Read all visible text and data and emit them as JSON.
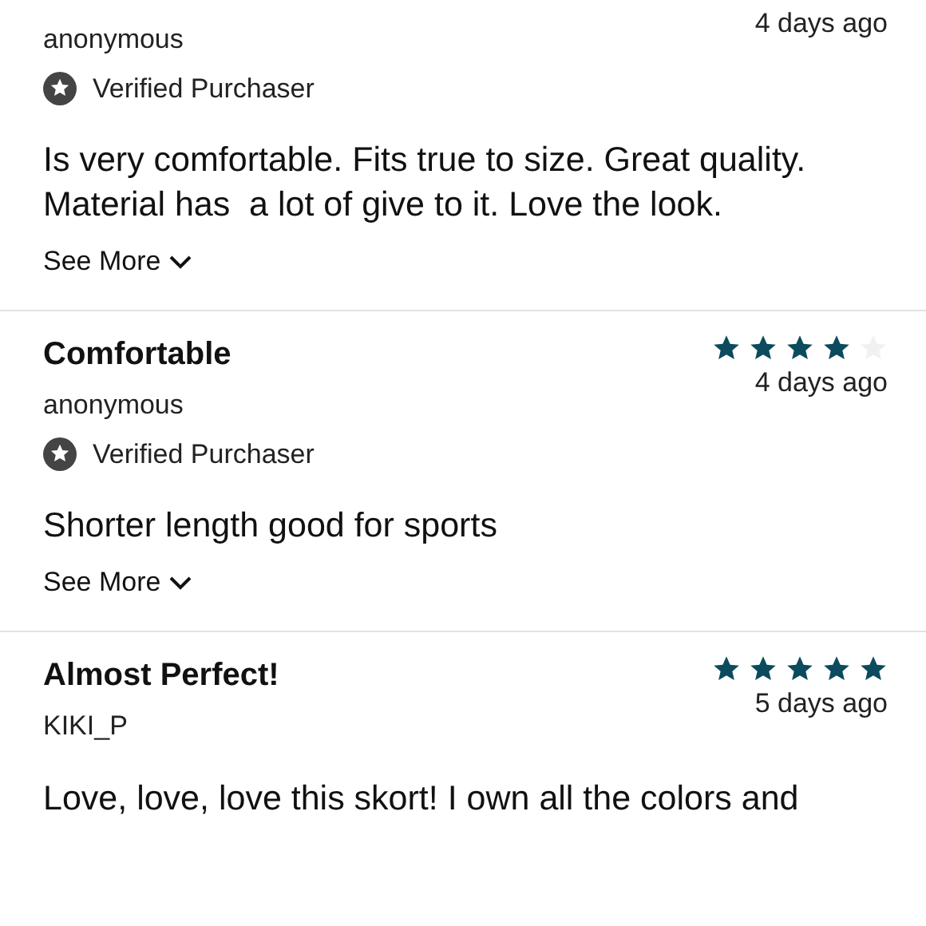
{
  "reviews": [
    {
      "author": "anonymous",
      "date": "4 days ago",
      "verified": true,
      "verified_label": "Verified Purchaser",
      "body": "Is very comfortable. Fits true to size. Great quality. Material has  a lot of give to it. Love the look.",
      "see_more": "See More"
    },
    {
      "title": "Comfortable",
      "stars": 4,
      "author": "anonymous",
      "date": "4 days ago",
      "verified": true,
      "verified_label": "Verified Purchaser",
      "body": "Shorter length good for sports",
      "see_more": "See More"
    },
    {
      "title": "Almost Perfect!",
      "stars": 5,
      "author": "KIKI_P",
      "date": "5 days ago",
      "body": "Love, love, love this skort! I own all the colors and"
    }
  ]
}
